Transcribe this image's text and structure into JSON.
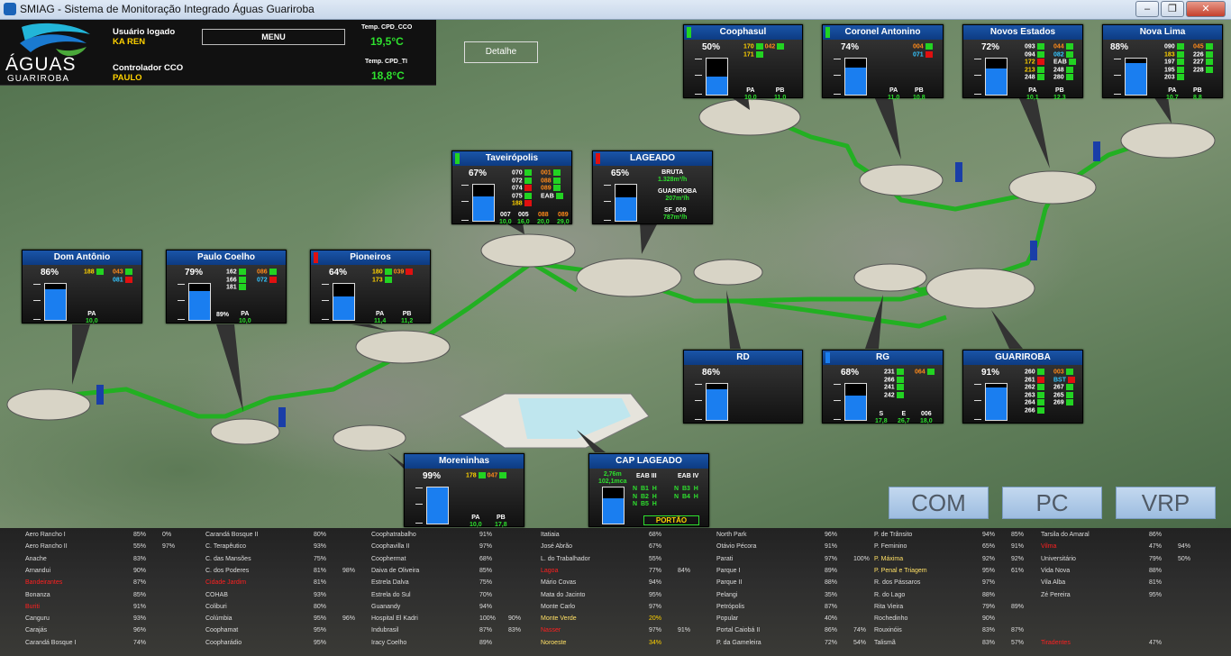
{
  "window": {
    "title": "SMIAG - Sistema de Monitoração Integrado Águas Guariroba",
    "controls": [
      "‒",
      "❐",
      "✕"
    ]
  },
  "header": {
    "logo_line1": "ÁGUAS",
    "logo_line2": "GUARIROBA",
    "user_label": "Usuário logado",
    "user_value": "KA REN",
    "ctrl_label": "Controlador CCO",
    "ctrl_value": "PAULO",
    "menu": "MENU",
    "temp1_label": "Temp. CPD_CCO",
    "temp1_value": "19,5°C",
    "temp2_label": "Temp. CPD_TI",
    "temp2_value": "18,8°C"
  },
  "detalhe": "Detalhe",
  "panels": {
    "coophasul": {
      "title": "Coophasul",
      "pct": "50%",
      "level": 0.5,
      "ind": "#22d322",
      "r1a": "170",
      "r1b": "042",
      "r2a": "171",
      "pa": "PA",
      "pa_v": "10,0",
      "pb": "PB",
      "pb_v": "11,0"
    },
    "coronel": {
      "title": "Coronel Antonino",
      "pct": "74%",
      "level": 0.74,
      "ind": "#22d322",
      "r1": "004",
      "r2": "071",
      "pa": "PA",
      "pa_v": "11,0",
      "pb": "PB",
      "pb_v": "10,8"
    },
    "novos": {
      "title": "Novos Estados",
      "pct": "72%",
      "level": 0.72,
      "a": [
        "093",
        "094",
        "172",
        "213",
        "248"
      ],
      "b": [
        "044",
        "082",
        "EAB",
        "248",
        "280"
      ],
      "pa": "PA",
      "pa_v": "10,1",
      "pb": "PB",
      "pb_v": "12,3"
    },
    "novalima": {
      "title": "Nova Lima",
      "pct": "88%",
      "level": 0.88,
      "a": [
        "090",
        "183",
        "197",
        "195",
        "203"
      ],
      "b": [
        "045",
        "226",
        "227",
        "228"
      ],
      "pa": "PA",
      "pa_v": "10,7",
      "pb": "PB",
      "pb_v": "8,8"
    },
    "taveiro": {
      "title": "Taveirópolis",
      "pct": "67%",
      "level": 0.67,
      "ind": "#22d322",
      "a": [
        "070",
        "072",
        "074",
        "075",
        "188"
      ],
      "b": [
        "001",
        "088",
        "089",
        "EAB"
      ],
      "bl": [
        "007",
        "005",
        "088",
        "089"
      ],
      "blv": [
        "10,0",
        "16,0",
        "20,0",
        "29,0"
      ]
    },
    "lageado": {
      "title": "LAGEADO",
      "pct": "65%",
      "level": 0.65,
      "ind": "#e01010",
      "bruta": "BRUTA",
      "bruta_v": "1.328m³/h",
      "guar": "GUARIROBA",
      "guar_v": "207m³/h",
      "sf": "SF_009",
      "sf_v": "787m³/h"
    },
    "domantonio": {
      "title": "Dom Antônio",
      "pct": "86%",
      "level": 0.86,
      "r1a": "188",
      "r1b": "043",
      "r2b": "081",
      "pa": "PA",
      "pa_v": "10,0"
    },
    "paulocoelho": {
      "title": "Paulo Coelho",
      "pct": "79%",
      "level": 0.79,
      "a": [
        "162",
        "166",
        "181"
      ],
      "b": [
        "086",
        "072"
      ],
      "mid": "89%",
      "pa": "PA",
      "pa_v": "10,0"
    },
    "pioneiros": {
      "title": "Pioneiros",
      "pct": "64%",
      "level": 0.64,
      "ind": "#e01010",
      "r1a": "180",
      "r1b": "039",
      "r2a": "173",
      "pa": "PA",
      "pa_v": "11,4",
      "pb": "PB",
      "pb_v": "11,2"
    },
    "rd": {
      "title": "RD",
      "pct": "86%",
      "level": 0.86
    },
    "rg": {
      "title": "RG",
      "pct": "68%",
      "level": 0.68,
      "ind": "#1a7ef0",
      "a": [
        "231",
        "266",
        "241",
        "242"
      ],
      "b": [
        "064"
      ],
      "s": "S",
      "s_v": "17,8",
      "e": "E",
      "e_v": "26,7",
      "x": "006",
      "x_v": "18,0"
    },
    "guariroba": {
      "title": "GUARIROBA",
      "pct": "91%",
      "level": 0.91,
      "a": [
        "260",
        "261",
        "262",
        "263",
        "264",
        "266"
      ],
      "b": [
        "003",
        "BST",
        "267",
        "265",
        "269"
      ]
    },
    "moreninhas": {
      "title": "Moreninhas",
      "pct": "99%",
      "level": 0.99,
      "r1a": "178",
      "r1b": "047",
      "pa": "PA",
      "pa_v": "10,0",
      "pb": "PB",
      "pb_v": "17,8"
    },
    "cap": {
      "title": "CAP LAGEADO",
      "lvl": "2,76m",
      "flow": "102,1mca",
      "eab3": "EAB III",
      "eab4": "EAB IV",
      "rows3": [
        [
          "N",
          "B1",
          "H"
        ],
        [
          "N",
          "B2",
          "H"
        ],
        [
          "N",
          "B5",
          "H"
        ]
      ],
      "rows4": [
        [
          "N",
          "B3",
          "H"
        ],
        [
          "N",
          "B4",
          "H"
        ]
      ],
      "portao": "PORTÃO",
      "level": 0.7
    }
  },
  "buttons": {
    "com": "COM",
    "pc": "PC",
    "vrp": "VRP"
  },
  "table": {
    "col1": [
      [
        "Aero Rancho I",
        "85%",
        "0%"
      ],
      [
        "Aero Rancho II",
        "55%",
        "97%"
      ],
      [
        "Anache",
        "83%",
        ""
      ],
      [
        "Arnandui",
        "90%",
        ""
      ],
      [
        "Bandeirantes",
        "87%",
        ""
      ],
      [
        "Bonanza",
        "85%",
        ""
      ],
      [
        "Buriti",
        "91%",
        ""
      ],
      [
        "Canguru",
        "93%",
        ""
      ],
      [
        "Carajás",
        "96%",
        ""
      ],
      [
        "Carandá Bosque I",
        "74%",
        ""
      ]
    ],
    "col2": [
      [
        "Carandá Bosque II",
        "80%",
        ""
      ],
      [
        "C. Terapêutico",
        "93%",
        ""
      ],
      [
        "C. das Mansões",
        "75%",
        ""
      ],
      [
        "C. dos Poderes",
        "81%",
        "98%"
      ],
      [
        "Cidade Jardim",
        "81%",
        ""
      ],
      [
        "COHAB",
        "93%",
        ""
      ],
      [
        "Coliburi",
        "80%",
        ""
      ],
      [
        "Colúmbia",
        "95%",
        "96%"
      ],
      [
        "Coophamat",
        "95%",
        ""
      ],
      [
        "Coopharádio",
        "95%",
        ""
      ]
    ],
    "col3": [
      [
        "Coophatrabalho",
        "91%",
        ""
      ],
      [
        "Coophavilla II",
        "97%",
        ""
      ],
      [
        "Coophermat",
        "68%",
        ""
      ],
      [
        "Daiva de Oliveira",
        "85%",
        ""
      ],
      [
        "Estrela Dalva",
        "75%",
        ""
      ],
      [
        "Estrela do Sul",
        "70%",
        ""
      ],
      [
        "Guanandy",
        "94%",
        ""
      ],
      [
        "Hospital El Kadri",
        "100%",
        "90%"
      ],
      [
        "Indubrasil",
        "87%",
        "83%"
      ],
      [
        "Iracy Coelho",
        "89%",
        ""
      ]
    ],
    "col4": [
      [
        "Itatiaia",
        "68%",
        ""
      ],
      [
        "José Abrão",
        "67%",
        ""
      ],
      [
        "L. do Trabalhador",
        "55%",
        ""
      ],
      [
        "Lagoa",
        "77%",
        "84%"
      ],
      [
        "Mário Covas",
        "94%",
        ""
      ],
      [
        "Mata do Jacinto",
        "95%",
        ""
      ],
      [
        "Monte Carlo",
        "97%",
        ""
      ],
      [
        "Monte Verde",
        "20%",
        ""
      ],
      [
        "Nasser",
        "97%",
        "91%"
      ],
      [
        "Noroeste",
        "34%",
        ""
      ]
    ],
    "col5": [
      [
        "North Park",
        "96%",
        ""
      ],
      [
        "Otávio Pécora",
        "91%",
        ""
      ],
      [
        "Parati",
        "97%",
        "100%"
      ],
      [
        "Parque I",
        "89%",
        ""
      ],
      [
        "Parque II",
        "88%",
        ""
      ],
      [
        "Pelangi",
        "35%",
        ""
      ],
      [
        "Petrópolis",
        "87%",
        ""
      ],
      [
        "Popular",
        "40%",
        ""
      ],
      [
        "Portal Caiobá II",
        "86%",
        "74%"
      ],
      [
        "P. da Gameleira",
        "72%",
        "54%"
      ]
    ],
    "col6": [
      [
        "P. de Trânsito",
        "94%",
        "85%"
      ],
      [
        "P. Feminino",
        "65%",
        "91%"
      ],
      [
        "P. Máxima",
        "92%",
        "92%"
      ],
      [
        "P. Penal e Triagem",
        "95%",
        "61%"
      ],
      [
        "R. dos Pássaros",
        "97%",
        ""
      ],
      [
        "R. do Lago",
        "88%",
        ""
      ],
      [
        "Rita Vieira",
        "79%",
        "89%"
      ],
      [
        "Rochedinho",
        "90%",
        ""
      ],
      [
        "Rouxinóis",
        "83%",
        "87%"
      ],
      [
        "Talismã",
        "83%",
        "57%"
      ]
    ],
    "col7": [
      [
        "Tarsila do Amaral",
        "86%",
        ""
      ],
      [
        "Vilma",
        "47%",
        "94%"
      ],
      [
        "Universitário",
        "79%",
        "50%"
      ],
      [
        "Vida Nova",
        "88%",
        ""
      ],
      [
        "Vila Alba",
        "81%",
        ""
      ],
      [
        "Zé Pereira",
        "95%",
        ""
      ],
      [
        "",
        "",
        ""
      ],
      [
        "",
        "",
        ""
      ],
      [
        "",
        "",
        ""
      ],
      [
        "Tiradentes",
        "47%",
        ""
      ]
    ]
  }
}
